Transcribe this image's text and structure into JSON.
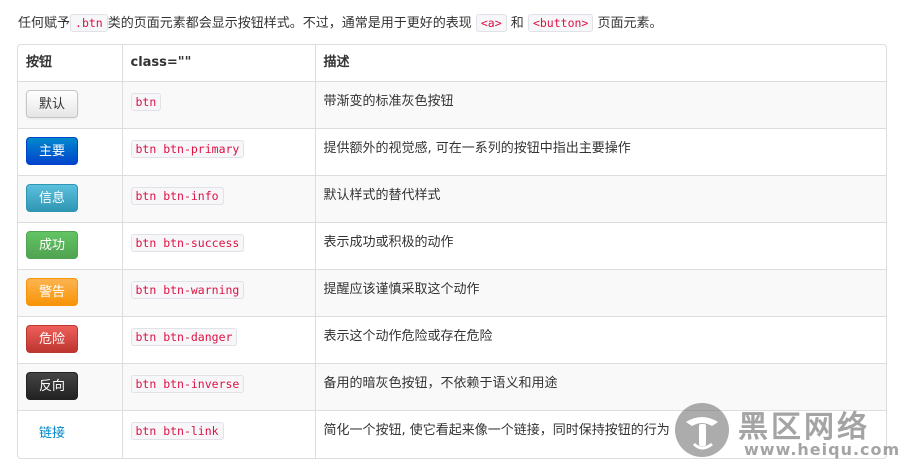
{
  "intro": {
    "text_before": "任何赋予",
    "code_btn": ".btn",
    "text_middle": "类的页面元素都会显示按钮样式。不过，通常是用于更好的表现",
    "code_a": "<a>",
    "text_and": "和",
    "code_button": "<button>",
    "text_after": "页面元素。"
  },
  "table": {
    "headers": [
      "按钮",
      "class=\"\"",
      "描述"
    ],
    "rows": [
      {
        "button_label": "默认",
        "class_name": "btn",
        "description": "带渐变的标准灰色按钮"
      },
      {
        "button_label": "主要",
        "class_name": "btn btn-primary",
        "description": "提供额外的视觉感, 可在一系列的按钮中指出主要操作"
      },
      {
        "button_label": "信息",
        "class_name": "btn btn-info",
        "description": "默认样式的替代样式"
      },
      {
        "button_label": "成功",
        "class_name": "btn btn-success",
        "description": "表示成功或积极的动作"
      },
      {
        "button_label": "警告",
        "class_name": "btn btn-warning",
        "description": "提醒应该谨慎采取这个动作"
      },
      {
        "button_label": "危险",
        "class_name": "btn btn-danger",
        "description": "表示这个动作危险或存在危险"
      },
      {
        "button_label": "反向",
        "class_name": "btn btn-inverse",
        "description": "备用的暗灰色按钮，不依赖于语义和用途"
      },
      {
        "button_label": "链接",
        "class_name": "btn btn-link",
        "description": "简化一个按钮, 使它看起来像一个链接，同时保持按钮的行为"
      }
    ]
  },
  "watermark": {
    "title": "黑区网络",
    "url": "www.heiqu.com"
  },
  "colors": {
    "code_text": "#dd1144",
    "primary": "#0044cc",
    "info": "#2f96b4",
    "success": "#51a351",
    "warning": "#f89406",
    "danger": "#bd362f",
    "inverse": "#222222",
    "link": "#0088cc"
  }
}
